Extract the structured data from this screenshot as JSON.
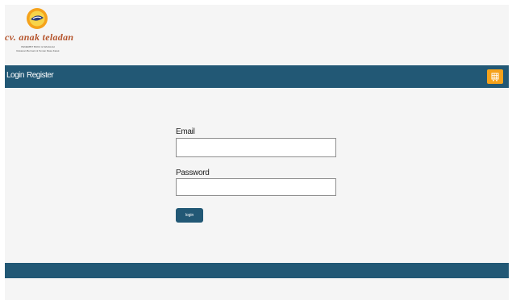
{
  "logo": {
    "title": "cv. anak teladan",
    "tagline": "PENERBIT BUKU & MAJALAH",
    "subtag": "Rekanan Bermain & Teman Rasa Karek",
    "emblem_color": "#f5a21b"
  },
  "nav": {
    "login_label": "Login",
    "register_label": "Register",
    "background": "#225875"
  },
  "cart": {
    "icon": "shopping-cart-icon",
    "color": "#f5a21b"
  },
  "form": {
    "email_label": "Email",
    "email_value": "",
    "password_label": "Password",
    "password_value": "",
    "submit_label": "login"
  }
}
